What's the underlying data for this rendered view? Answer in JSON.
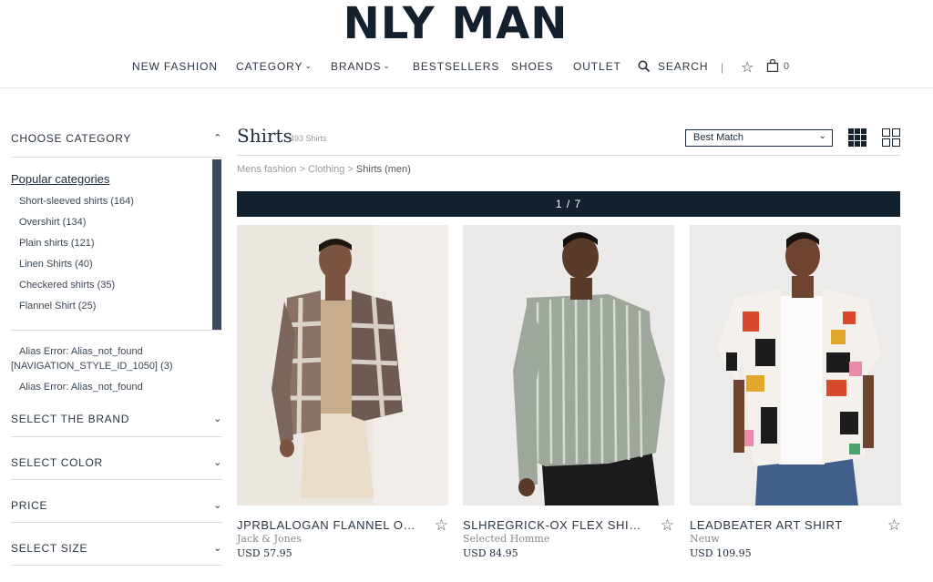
{
  "logo": "NLY MAN",
  "nav": {
    "new_fashion": "NEW FASHION",
    "category": "CATEGORY",
    "brands": "BRANDS",
    "bestsellers": "BESTSELLERS",
    "shoes": "SHOES",
    "outlet": "OUTLET",
    "search": "SEARCH",
    "separator": "|",
    "bag_count": "0"
  },
  "sidebar": {
    "choose_category": "CHOOSE CATEGORY",
    "popular_title": "Popular categories",
    "categories": [
      "Short-sleeved shirts (164)",
      "Overshirt (134)",
      "Plain shirts (121)",
      "Linen Shirts (40)",
      "Checkered shirts (35)",
      "Flannel Shirt (25)"
    ],
    "alias_1_line_1": "Alias Error: Alias_not_found",
    "alias_1_line_2": "[NAVIGATION_STYLE_ID_1050] (3)",
    "alias_2": "Alias Error: Alias_not_found",
    "filters": [
      "SELECT THE BRAND",
      "SELECT COLOR",
      "PRICE",
      "SELECT SIZE"
    ]
  },
  "main": {
    "title": "Shirts",
    "count": "493 Shirts",
    "sort_selected": "Best Match",
    "breadcrumb": [
      "Mens fashion",
      "Clothing",
      "Shirts (men)"
    ],
    "breadcrumb_sep": ">",
    "pager": "1 / 7"
  },
  "products": [
    {
      "name": "JPRBLALOGAN FLANNEL OVERSHIRT",
      "brand": "Jack & Jones",
      "price": "USD 57.95"
    },
    {
      "name": "SLHREGRICK-OX FLEX SHIRT",
      "brand": "Selected Homme",
      "price": "USD 84.95"
    },
    {
      "name": "LEADBEATER ART SHIRT",
      "brand": "Neuw",
      "price": "USD 109.95"
    }
  ],
  "colors": {
    "navy": "#13202e",
    "scrollbar": "#3a4b61"
  }
}
